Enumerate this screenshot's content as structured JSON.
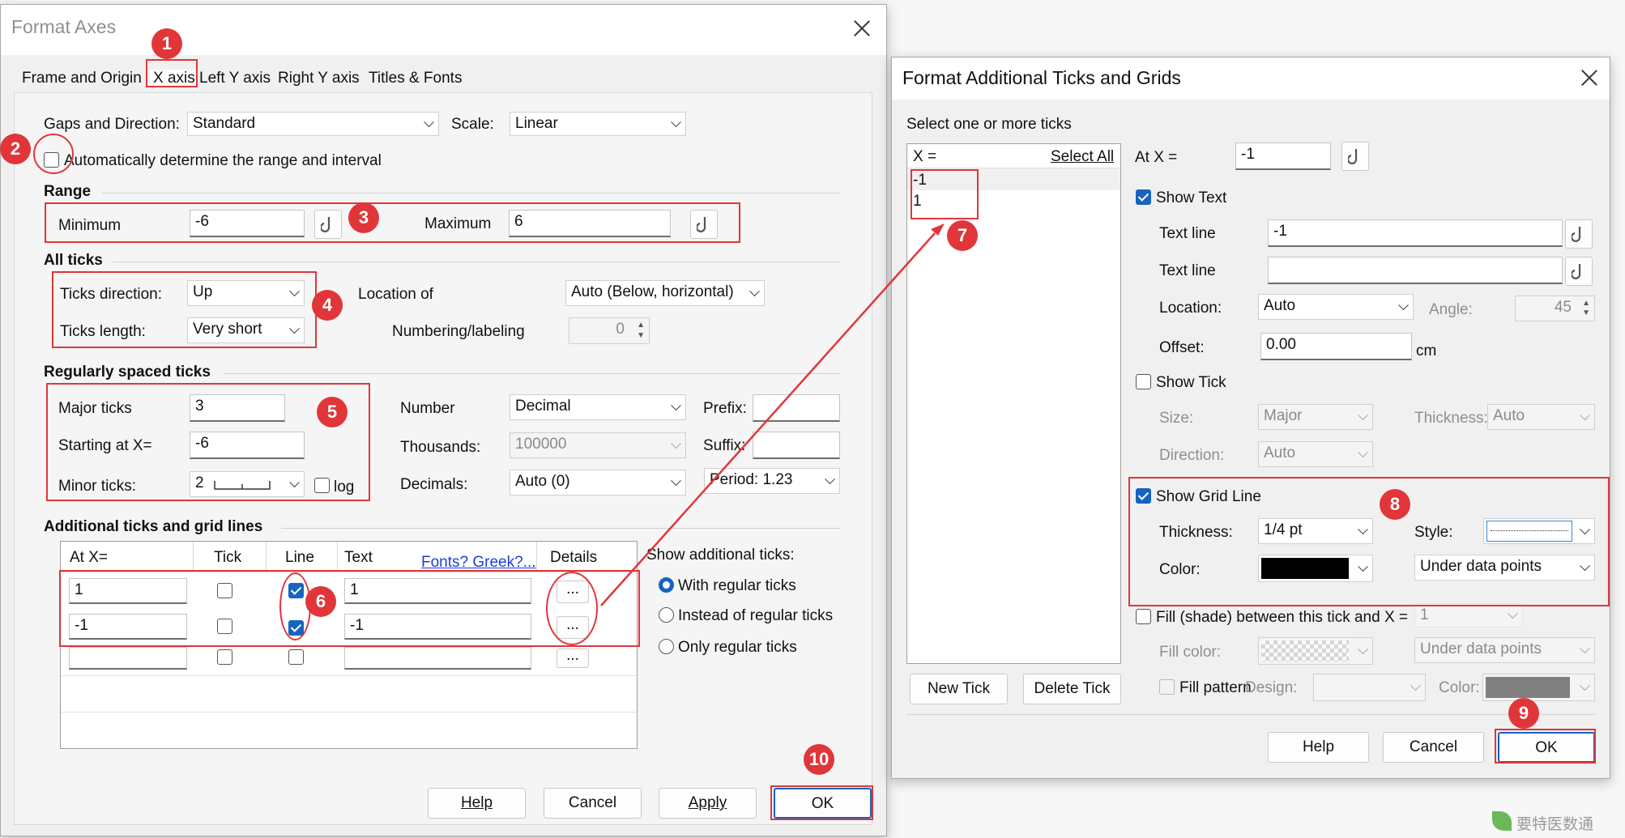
{
  "format_axes": {
    "title": "Format Axes",
    "tabs": [
      "Frame and Origin",
      "X axis",
      "Left Y axis",
      "Right Y axis",
      "Titles & Fonts"
    ],
    "gaps_label": "Gaps and Direction:",
    "gaps_value": "Standard",
    "scale_label": "Scale:",
    "scale_value": "Linear",
    "auto_label": "Automatically determine the range and interval",
    "range_heading": "Range",
    "min_label": "Minimum",
    "min_value": "-6",
    "max_label": "Maximum",
    "max_value": "6",
    "all_ticks_heading": "All ticks",
    "ticks_dir_label": "Ticks direction:",
    "ticks_dir_value": "Up",
    "ticks_len_label": "Ticks length:",
    "ticks_len_value": "Very short",
    "location_label": "Location of",
    "location_value": "Auto (Below, horizontal)",
    "numbering_label": "Numbering/labeling",
    "numbering_value": "0",
    "regular_heading": "Regularly spaced ticks",
    "major_label": "Major ticks",
    "major_value": "3",
    "start_label": "Starting at X=",
    "start_value": "-6",
    "minor_label": "Minor ticks:",
    "minor_value": "2",
    "log_label": "log",
    "number_label": "Number",
    "number_value": "Decimal",
    "thousands_label": "Thousands:",
    "thousands_value": "100000",
    "decimals_label": "Decimals:",
    "decimals_value": "Auto (0)",
    "prefix_label": "Prefix:",
    "suffix_label": "Suffix:",
    "period_label": "Period: 1.23",
    "additional_heading": "Additional ticks and grid lines",
    "table_headers": [
      "At X=",
      "Tick",
      "Line",
      "Text",
      "Details"
    ],
    "fonts_link": "Fonts? Greek?...",
    "rows": [
      {
        "at": "1",
        "text": "1",
        "details": "..."
      },
      {
        "at": "-1",
        "text": "-1",
        "details": "..."
      },
      {
        "at": "",
        "text": "",
        "details": "..."
      }
    ],
    "show_additional_label": "Show additional ticks:",
    "radio_options": [
      "With regular ticks",
      "Instead of regular ticks",
      "Only regular ticks"
    ],
    "buttons": {
      "help": "Help",
      "cancel": "Cancel",
      "apply": "Apply",
      "ok": "OK"
    }
  },
  "format_ticks": {
    "title": "Format Additional Ticks and Grids",
    "select_label": "Select one or more ticks",
    "list_header": "X =",
    "select_all": "Select All",
    "list_items": [
      "-1",
      "1"
    ],
    "at_x_label": "At X =",
    "at_x_value": "-1",
    "show_text_label": "Show Text",
    "text_line_label": "Text line",
    "text_line_1": "-1",
    "text_line_2": "",
    "location_label": "Location:",
    "location_value": "Auto",
    "angle_label": "Angle:",
    "angle_value": "45",
    "offset_label": "Offset:",
    "offset_value": "0.00",
    "offset_unit": "cm",
    "show_tick_label": "Show Tick",
    "size_label": "Size:",
    "size_value": "Major",
    "thickness_label": "Thickness:",
    "thickness_value": "Auto",
    "direction_label": "Direction:",
    "direction_value": "Auto",
    "show_grid_label": "Show Grid Line",
    "grid_thickness_label": "Thickness:",
    "grid_thickness_value": "1/4 pt",
    "style_label": "Style:",
    "color_label": "Color:",
    "order_value": "Under data points",
    "fill_label": "Fill (shade) between this tick and X =",
    "fill_value": "1",
    "fill_color_label": "Fill color:",
    "fill_order_value": "Under data points",
    "fill_pattern_label": "Fill pattern",
    "design_label": "Design:",
    "pattern_color_label": "Color:",
    "buttons": {
      "new_tick": "New Tick",
      "delete_tick": "Delete Tick",
      "help": "Help",
      "cancel": "Cancel",
      "ok": "OK"
    }
  },
  "annotations": [
    "1",
    "2",
    "3",
    "4",
    "5",
    "6",
    "7",
    "8",
    "9",
    "10"
  ],
  "watermark": "要特医数通",
  "colors": {
    "annotation": "#e0363a",
    "accent": "#1764c0",
    "grid_color": "#000000",
    "pattern_color": "#808080"
  }
}
